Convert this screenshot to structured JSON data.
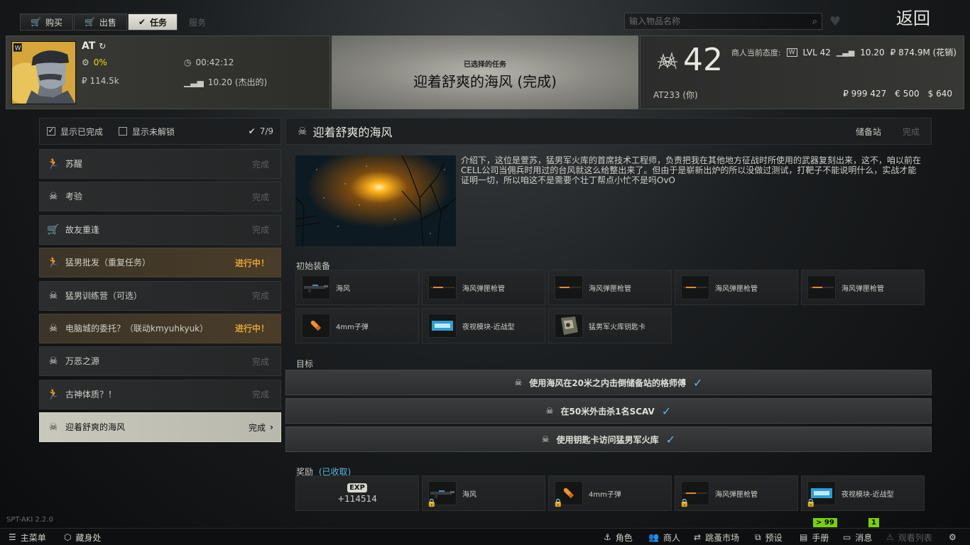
{
  "nav": {
    "tabs": [
      {
        "label": "购买",
        "icon": "cart-icon"
      },
      {
        "label": "出售",
        "icon": "sell-cart-icon"
      },
      {
        "label": "任务",
        "icon": "check-circle-icon"
      },
      {
        "label": "服务",
        "icon": ""
      }
    ],
    "search_placeholder": "输入物品名称",
    "back_label": "返回"
  },
  "player": {
    "name": "AT",
    "progress": "0%",
    "time": "00:42:12",
    "roubles": "₽ 114.5k",
    "rating": "10.20 (杰出的)"
  },
  "selected_quest": {
    "label": "已选择的任务",
    "title": "迎着舒爽的海风 (完成)"
  },
  "trader": {
    "level": "42",
    "name": "AT233 (你)",
    "standing_label": "商人当前态度:",
    "lvl": "LVL 42",
    "standing": "10.20",
    "sales": "₽ 874.9M (花销)",
    "money_rub": "₽ 999 427",
    "money_eur": "€ 500",
    "money_usd": "$ 640"
  },
  "filters": {
    "show_completed": "显示已完成",
    "show_locked": "显示未解锁",
    "count": "7/9"
  },
  "quests": [
    {
      "name": "苏醒",
      "status": "完成",
      "icon": "running-man-icon",
      "state": "done"
    },
    {
      "name": "考验",
      "status": "完成",
      "icon": "skull-icon",
      "state": "done"
    },
    {
      "name": "故友重逢",
      "status": "完成",
      "icon": "cart-icon",
      "state": "done"
    },
    {
      "name": "猛男批发（重复任务）",
      "status": "进行中！",
      "icon": "running-man-icon",
      "state": "progress"
    },
    {
      "name": "猛男训练营（可选）",
      "status": "完成",
      "icon": "skull-icon",
      "state": "done"
    },
    {
      "name": "电脑城的委托？（联动kmyuhkyuk）",
      "status": "进行中！",
      "icon": "skull-icon",
      "state": "progress"
    },
    {
      "name": "万恶之源",
      "status": "完成",
      "icon": "skull-icon",
      "state": "done"
    },
    {
      "name": "古神体质？！",
      "status": "完成",
      "icon": "running-man-icon",
      "state": "done"
    },
    {
      "name": "迎着舒爽的海风",
      "status": "完成",
      "icon": "skull-icon",
      "state": "selected"
    }
  ],
  "detail": {
    "title": "迎着舒爽的海风",
    "location": "储备站",
    "status": "完成",
    "description": "介绍下，这位是萱苏，猛男军火库的首席技术工程师，负责把我在其他地方征战时所使用的武器复刻出来，这不，咱以前在CELL公司当佣兵时用过的台风就这么给整出来了。但由于是崭新出炉的所以没做过测试，打靶子不能说明什么，实战才能证明一切，所以咱这不是需要个壮丁帮点小忙不是吗OvO",
    "starting_label": "初始装备",
    "starting_items": [
      {
        "name": "海风",
        "icon": "rifle-icon"
      },
      {
        "name": "海风弹匣枪管",
        "icon": "barrel-icon"
      },
      {
        "name": "海风弹匣枪管",
        "icon": "barrel-icon"
      },
      {
        "name": "海风弹匣枪管",
        "icon": "barrel-icon"
      },
      {
        "name": "海风弹匣枪管",
        "icon": "barrel-icon"
      },
      {
        "name": "4mm子弹",
        "icon": "bullet-icon"
      },
      {
        "name": "夜视模块-近战型",
        "icon": "module-icon"
      },
      {
        "name": "猛男军火库钥匙卡",
        "icon": "keycard-icon"
      }
    ],
    "objectives_label": "目标",
    "objectives": [
      "使用海风在20米之内击倒储备站的格师傅",
      "在50米外击杀1名SCAV",
      "使用钥匙卡访问猛男军火库"
    ],
    "rewards_label": "奖励",
    "rewards_status": "(已收取)",
    "exp_label": "EXP",
    "exp_value": "+114514",
    "reward_items": [
      {
        "name": "海风",
        "icon": "rifle-icon"
      },
      {
        "name": "4mm子弹",
        "icon": "bullet-icon"
      },
      {
        "name": "海风弹匣枪管",
        "icon": "barrel-icon"
      },
      {
        "name": "夜视模块-近战型",
        "icon": "module-icon"
      }
    ]
  },
  "footer": {
    "version": "SPT-AKI 2.2.0",
    "main_menu": "主菜单",
    "hideout": "藏身处",
    "character": "角色",
    "traders": "商人",
    "flea": "跳蚤市场",
    "presets": "预设",
    "handbook": "手册",
    "messages": "消息",
    "watchlist": "观看列表",
    "handbook_badge": "> 99",
    "messages_badge": "1"
  },
  "colors": {
    "accent_check": "#62b7e3",
    "in_progress": "#e3a33a",
    "badge_green": "#7ad000",
    "yellow": "#f0d800"
  }
}
